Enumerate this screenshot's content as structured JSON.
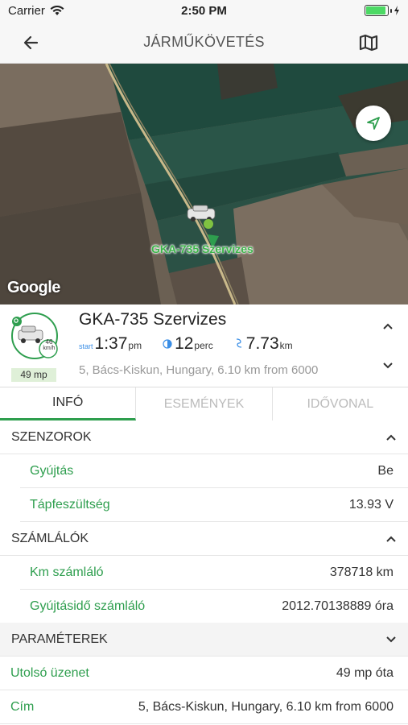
{
  "status_bar": {
    "carrier": "Carrier",
    "time": "2:50 PM",
    "battery_level": 0.95
  },
  "header": {
    "title": "JÁRMŰKÖVETÉS"
  },
  "map": {
    "vehicle_label": "GKA-735 Szervizes",
    "attribution": "Google",
    "marker_letter": "b"
  },
  "vehicle": {
    "name": "GKA-735 Szervizes",
    "speed_value": "46",
    "speed_unit": "km/h",
    "ago_badge": "49 mp",
    "start_prefix": "start",
    "start_time": "1:37",
    "start_time_unit": "pm",
    "duration": "12",
    "duration_unit": "perc",
    "distance": "7.73",
    "distance_unit": "km",
    "address": "5, Bács-Kiskun, Hungary, 6.10 km from 6000"
  },
  "tabs": [
    {
      "label": "INFÓ",
      "active": true
    },
    {
      "label": "ESEMÉNYEK",
      "active": false
    },
    {
      "label": "IDŐVONAL",
      "active": false
    }
  ],
  "sections": {
    "sensors": {
      "title": "SZENZOROK",
      "rows": [
        {
          "label": "Gyújtás",
          "value": "Be"
        },
        {
          "label": "Tápfeszültség",
          "value": "13.93 V"
        }
      ]
    },
    "counters": {
      "title": "SZÁMLÁLÓK",
      "rows": [
        {
          "label": "Km számláló",
          "value": "378718 km"
        },
        {
          "label": "Gyújtásidő számláló",
          "value": "2012.70138889 óra"
        }
      ]
    },
    "parameters": {
      "title": "PARAMÉTEREK"
    }
  },
  "details": [
    {
      "label": "Utolsó üzenet",
      "value": "49 mp óta"
    },
    {
      "label": "Cím",
      "value": "5, Bács-Kiskun, Hungary, 6.10 km from 6000"
    }
  ],
  "colors": {
    "accent": "#2e9e4e",
    "link_blue": "#3a8ee6"
  }
}
